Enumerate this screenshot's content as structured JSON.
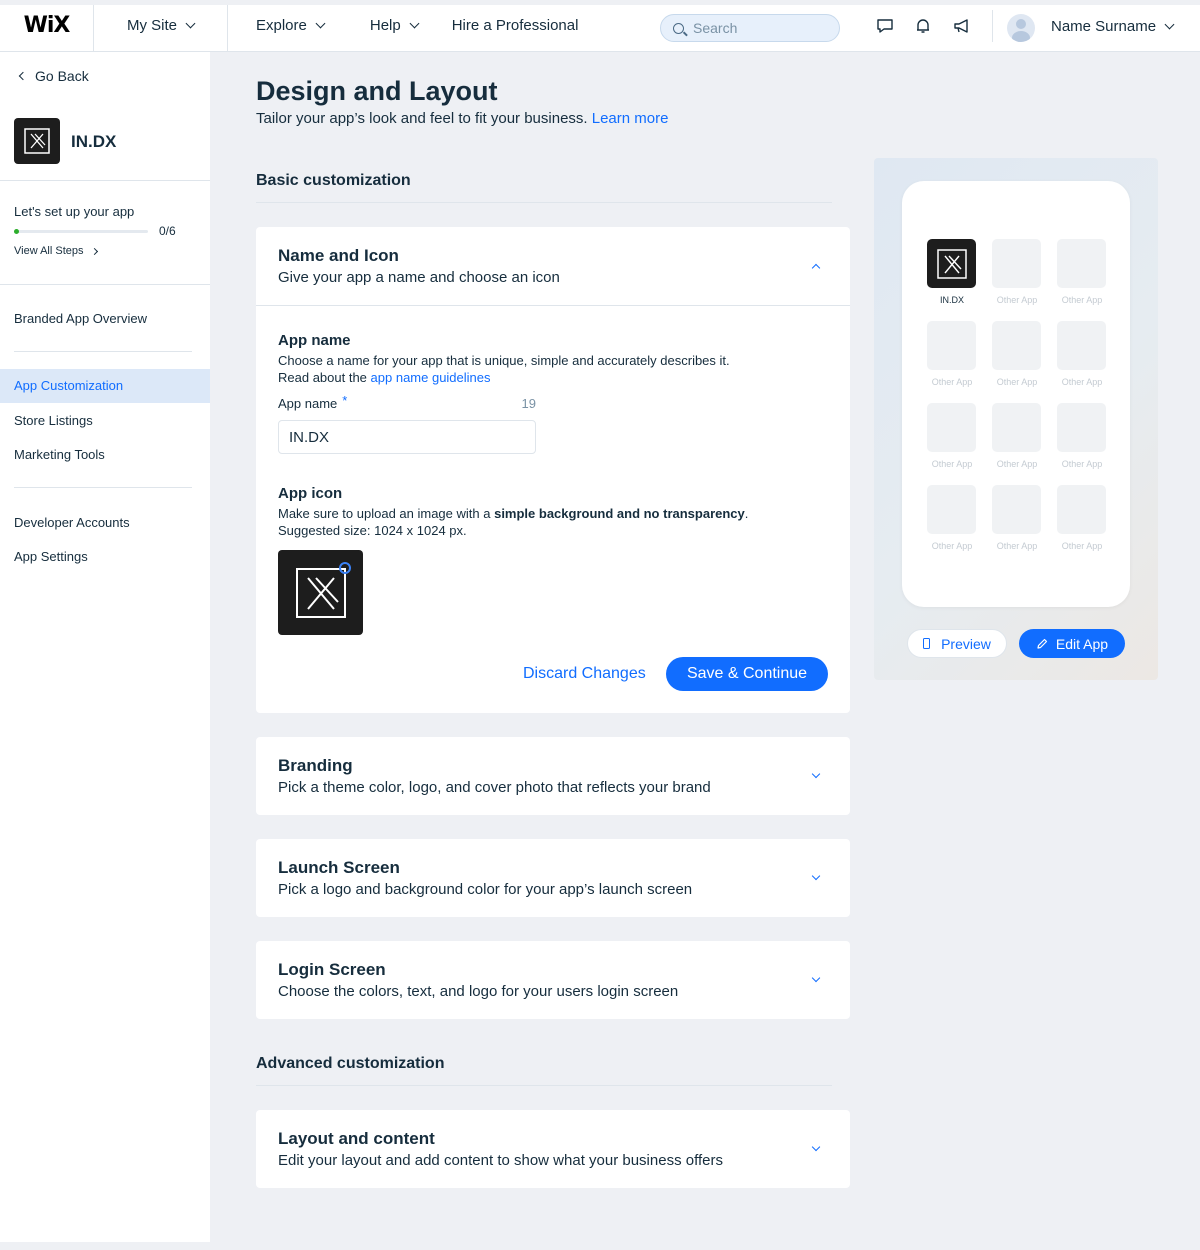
{
  "topbar": {
    "logo": "WiX",
    "my_site": "My Site",
    "nav": [
      "Explore",
      "Help",
      "Hire a Professional"
    ],
    "search_placeholder": "Search",
    "user_name": "Name Surname"
  },
  "sidebar": {
    "go_back": "Go Back",
    "app_title": "IN.DX",
    "setup_title": "Let's set up your app",
    "progress_count": "0/6",
    "progress_fraction": 0,
    "view_steps": "View All Steps",
    "overview": "Branded App Overview",
    "items": [
      "App Customization",
      "Store Listings",
      "Marketing Tools"
    ],
    "items2": [
      "Developer Accounts",
      "App Settings"
    ]
  },
  "main": {
    "title": "Design and Layout",
    "subtitle": "Tailor your app’s look and feel to fit your business.",
    "learn_more": "Learn more",
    "basic_title": "Basic customization",
    "advanced_title": "Advanced customization"
  },
  "name_card": {
    "title": "Name and Icon",
    "subtitle": "Give your app a name and choose an icon",
    "app_name_title": "App name",
    "app_name_desc": "Choose a name for your app that is unique, simple and accurately describes it.",
    "read_about": "Read about the",
    "guidelines_link": "app name guidelines",
    "field_label": "App name",
    "required_mark": "*",
    "char_count": "19",
    "field_value": "IN.DX",
    "app_icon_title": "App icon",
    "icon_desc_pre": "Make sure to upload an image with a",
    "icon_desc_bold": "simple background and no transparency",
    "icon_desc_post": ".",
    "icon_size": "Suggested size: 1024 x 1024 px.",
    "discard": "Discard Changes",
    "save": "Save & Continue"
  },
  "cards": {
    "branding": {
      "title": "Branding",
      "subtitle": "Pick a theme color, logo, and cover photo that reflects your brand"
    },
    "launch": {
      "title": "Launch Screen",
      "subtitle": "Pick a logo and background color for your app’s launch screen"
    },
    "login": {
      "title": "Login Screen",
      "subtitle": "Choose the colors, text, and logo for your users login screen"
    },
    "layout": {
      "title": "Layout and content",
      "subtitle": "Edit your layout and add content to show what your business offers"
    }
  },
  "preview": {
    "main_app_label": "IN.DX",
    "other_app_label": "Other App",
    "preview_button": "Preview",
    "edit_button": "Edit App"
  },
  "colors": {
    "accent": "#116dff",
    "text": "#162d3d",
    "page_bg": "#eef0f4",
    "active_nav_bg": "#dce8f8",
    "progress": "#2cae2c",
    "app_icon_bg": "#1d1d1d"
  }
}
